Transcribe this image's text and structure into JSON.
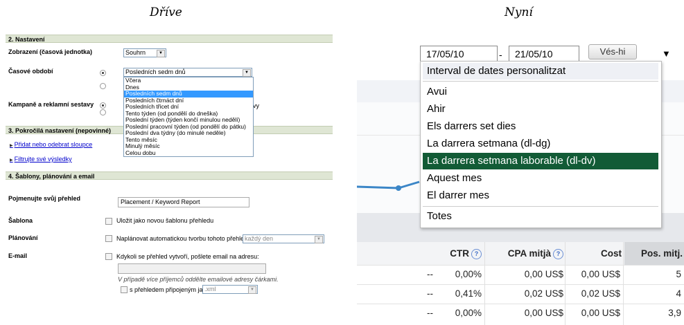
{
  "headers": {
    "before": "Dříve",
    "after": "Nyní"
  },
  "old_ui": {
    "sections": [
      "2. Nastavení",
      "3. Pokročilá nastavení (nepovinné)",
      "4. Šablony, plánování a email"
    ],
    "view_label": "Zobrazení (časová jednotka)",
    "view_value": "Souhrn",
    "period_label": "Časové období",
    "period_value": "Posledních sedm dnů",
    "dropdown_options": [
      "Včera",
      "Dnes",
      "Posledních sedm dnů",
      "Posledních čtrnáct dní",
      "Posledních třicet dní",
      "Tento týden (od pondělí do dneška)",
      "Poslední týden (týden končí minulou nedělí)",
      "Poslední pracovní týden (od pondělí do pátku)",
      "Poslední dva týdny (do minulé neděle)",
      "Tento měsíc",
      "Minulý měsíc",
      "Celou dobu"
    ],
    "campaigns_label": "Kampaně a reklamní sestavy",
    "campaigns_trailing": "vy",
    "link_columns": "Přidat nebo odebrat sloupce",
    "link_filter": "Filtrujte své výsledky",
    "name_label": "Pojmenujte svůj přehled",
    "name_value": "Placement / Keyword Report",
    "template_label": "Šablona",
    "template_text": "Uložit jako novou šablonu přehledu",
    "schedule_label": "Plánování",
    "schedule_text": "Naplánovat automatickou tvorbu tohoto přehledu:",
    "schedule_value": "každý den",
    "email_label": "E-mail",
    "email_text": "Kdykoli se přehled vytvoří, pošlete email na adresu:",
    "email_hint": "V případě více příjemců oddělte emailové adresy čárkami.",
    "attach_text": "s přehledem připojeným jako:",
    "attach_value": ".xml"
  },
  "new_ui": {
    "date_from": "17/05/10",
    "date_sep": "-",
    "date_to": "21/05/10",
    "go_label": "Vés-hi",
    "menu_items": [
      "Interval de dates personalitzat",
      "Avui",
      "Ahir",
      "Els darrers set dies",
      "La darrera setmana (dl-dg)",
      "La darrera setmana laborable (dl-dv)",
      "Aquest mes",
      "El darrer mes",
      "Totes"
    ],
    "columns": [
      "CTR",
      "CPA mitjà",
      "Cost",
      "Pos. mitj."
    ],
    "help_glyph": "?",
    "rows": [
      [
        "--",
        "0,00%",
        "0,00 US$",
        "0,00 US$",
        "5"
      ],
      [
        "--",
        "0,41%",
        "0,02 US$",
        "0,02 US$",
        "4"
      ],
      [
        "--",
        "0,00%",
        "0,00 US$",
        "0,00 US$",
        "3,9"
      ]
    ],
    "highlight_color": "#125b36"
  }
}
